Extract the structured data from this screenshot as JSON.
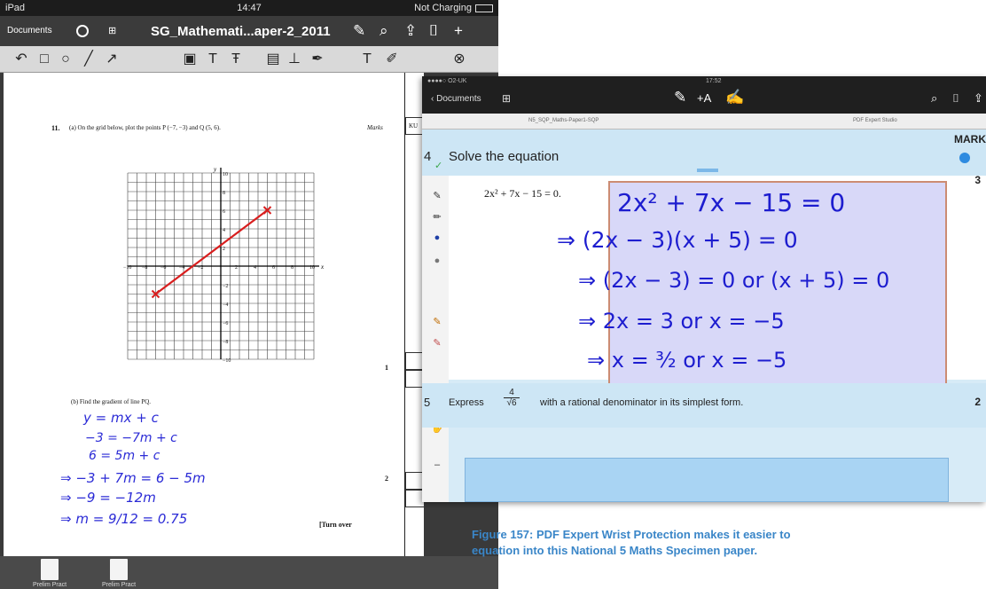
{
  "left_screen": {
    "status_bar": {
      "carrier": "iPad",
      "time": "14:47",
      "battery": "Not Charging"
    },
    "nav": {
      "documents_label": "Documents",
      "title": "SG_Mathemati...aper-2_2011"
    },
    "page": {
      "question_label": "11.",
      "part_a_text": "(a)  On the grid below, plot the points P (−7, −3) and Q (5, 6).",
      "marks_label": "Marks",
      "margin_code": "KU",
      "y_axis_label": "y",
      "x_axis_label": "x",
      "y_ticks": [
        "10",
        "8",
        "6",
        "4",
        "2",
        "",
        "−2",
        "−4",
        "−6",
        "−8",
        "−10"
      ],
      "x_ticks": [
        "−10",
        "−8",
        "−6",
        "−4",
        "−2",
        "",
        "2",
        "4",
        "6",
        "8",
        "10"
      ],
      "mark_a": "1",
      "part_b_text": "(b)  Find the gradient of line PQ.",
      "handwriting": [
        "y = mx + c",
        "−3 = −7m + c",
        "6 = 5m + c",
        "⇒  −3 + 7m = 6 − 5m",
        "⇒      −9 = −12m",
        "⇒      m = 9/12 = 0.75"
      ],
      "mark_b": "2",
      "turn_over": "[Turn over"
    },
    "line_points": {
      "P": [
        -7,
        -3
      ],
      "Q": [
        5,
        6
      ]
    },
    "bottom_docs": [
      {
        "label": "Prelim Pract"
      },
      {
        "label": "Prelim Pract"
      }
    ]
  },
  "right_screen": {
    "status": "●●●●○ O2-UK",
    "time": "17:52",
    "back_label": "Documents",
    "tabs": [
      "N5_SQP_Maths-Paper1-SQP",
      "",
      "PDF Expert Studio"
    ],
    "question4_number": "4",
    "question4_text": "Solve the equation",
    "marks_header": "MARK",
    "mark4": "3",
    "equation": "2x² + 7x − 15 = 0.",
    "ink_lines": [
      "2x² + 7x − 15 = 0",
      "⇒ (2x − 3)(x + 5) = 0",
      "⇒ (2x − 3) = 0  or  (x + 5) = 0",
      "⇒ 2x = 3   or   x = −5",
      "⇒ x = ³⁄₂   or   x = −5"
    ],
    "question5_number": "5",
    "question5_before": "Express",
    "question5_frac_num": "4",
    "question5_frac_den": "√6",
    "question5_after": "with a rational denominator in its simplest form.",
    "mark5": "2"
  },
  "caption": {
    "line1": "Figure 157: PDF Expert Wrist Protection makes it easier to",
    "line2": "equation into this National 5 Maths Specimen paper."
  },
  "colors": {
    "ink_blue": "#1d1dcf",
    "line_red": "#d81e1e",
    "caption_blue": "#3a86c8",
    "band_blue": "#cde6f5"
  }
}
